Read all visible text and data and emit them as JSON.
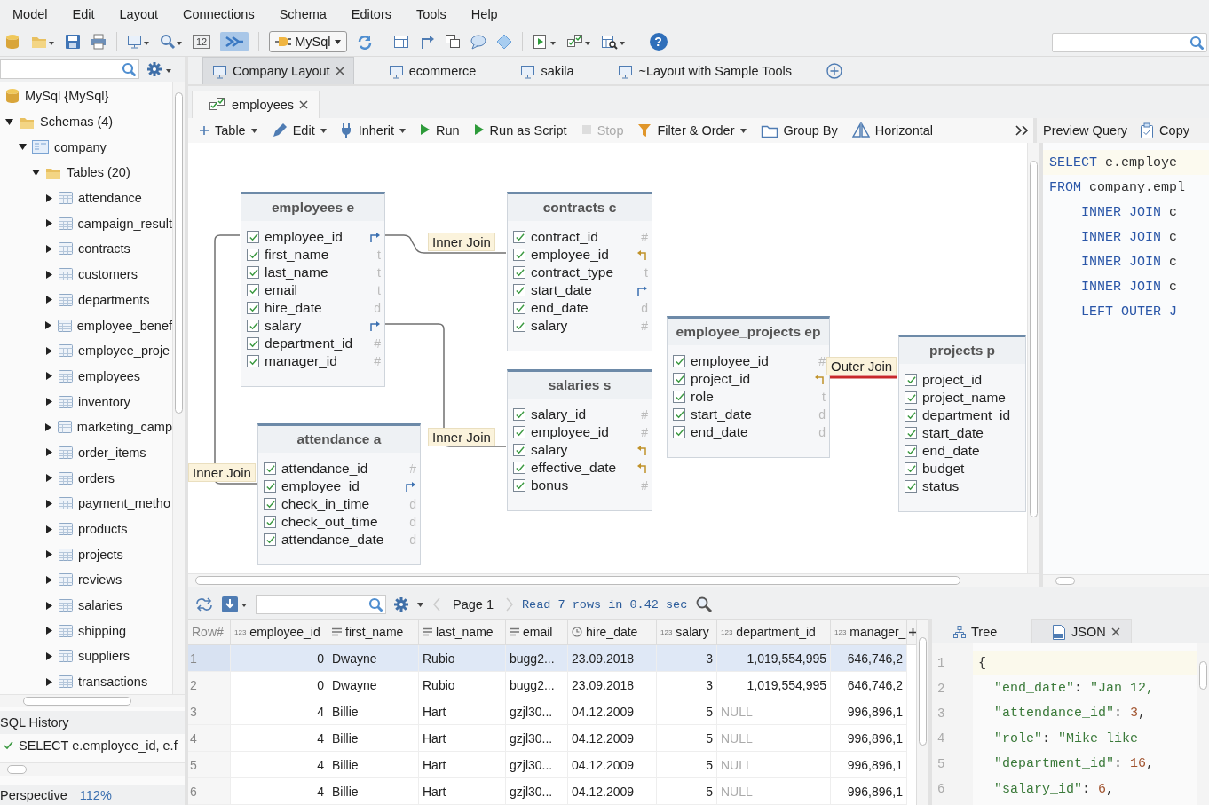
{
  "menu": [
    "Model",
    "Edit",
    "Layout",
    "Connections",
    "Schema",
    "Editors",
    "Tools",
    "Help"
  ],
  "toolbar": {
    "zoom_box": "12",
    "toggle_on": true,
    "connection": "MySql",
    "help": "?"
  },
  "navigator": {
    "tree": [
      {
        "label": "MySql {MySql}",
        "kind": "connection",
        "children": [
          {
            "label": "Schemas (4)",
            "kind": "folder",
            "expanded": true,
            "children": [
              {
                "label": "company",
                "kind": "schema",
                "expanded": true,
                "children": [
                  {
                    "label": "Tables (20)",
                    "kind": "folder",
                    "expanded": true,
                    "children": [
                      {
                        "label": "attendance",
                        "kind": "table",
                        "expanded": false
                      },
                      {
                        "label": "campaign_result",
                        "kind": "table",
                        "expanded": false
                      },
                      {
                        "label": "contracts",
                        "kind": "table",
                        "expanded": false
                      },
                      {
                        "label": "customers",
                        "kind": "table",
                        "expanded": false
                      },
                      {
                        "label": "departments",
                        "kind": "table",
                        "expanded": false
                      },
                      {
                        "label": "employee_benef",
                        "kind": "table",
                        "expanded": false
                      },
                      {
                        "label": "employee_proje",
                        "kind": "table",
                        "expanded": false
                      },
                      {
                        "label": "employees",
                        "kind": "table",
                        "expanded": false
                      },
                      {
                        "label": "inventory",
                        "kind": "table",
                        "expanded": false
                      },
                      {
                        "label": "marketing_camp",
                        "kind": "table",
                        "expanded": false
                      },
                      {
                        "label": "order_items",
                        "kind": "table",
                        "expanded": false
                      },
                      {
                        "label": "orders",
                        "kind": "table",
                        "expanded": false
                      },
                      {
                        "label": "payment_metho",
                        "kind": "table",
                        "expanded": false
                      },
                      {
                        "label": "products",
                        "kind": "table",
                        "expanded": false
                      },
                      {
                        "label": "projects",
                        "kind": "table",
                        "expanded": false
                      },
                      {
                        "label": "reviews",
                        "kind": "table",
                        "expanded": false
                      },
                      {
                        "label": "salaries",
                        "kind": "table",
                        "expanded": false
                      },
                      {
                        "label": "shipping",
                        "kind": "table",
                        "expanded": false
                      },
                      {
                        "label": "suppliers",
                        "kind": "table",
                        "expanded": false
                      },
                      {
                        "label": "transactions",
                        "kind": "table",
                        "expanded": false
                      }
                    ]
                  }
                ]
              }
            ]
          }
        ]
      }
    ],
    "history_title": "SQL History",
    "history": [
      {
        "text": "SELECT e.employee_id, e.f",
        "ok": true
      }
    ]
  },
  "status_bar": {
    "label": "Perspective",
    "zoom": "112%"
  },
  "layout_tabs": [
    {
      "label": "Company Layout",
      "selected": true,
      "closable": true
    },
    {
      "label": "ecommerce",
      "selected": false,
      "closable": false
    },
    {
      "label": "sakila",
      "selected": false,
      "closable": false
    },
    {
      "label": "~Layout with Sample Tools",
      "selected": false,
      "closable": false
    }
  ],
  "editor_tabs": [
    {
      "label": "employees",
      "selected": true,
      "closable": true
    }
  ],
  "query_toolbar": [
    {
      "label": "Table",
      "dropdown": true,
      "disabled": false
    },
    {
      "label": "Edit",
      "dropdown": true,
      "disabled": false
    },
    {
      "label": "Inherit",
      "dropdown": true,
      "disabled": false
    },
    {
      "label": "Run",
      "dropdown": false,
      "disabled": false
    },
    {
      "label": "Run as Script",
      "dropdown": false,
      "disabled": false
    },
    {
      "label": "Stop",
      "dropdown": false,
      "disabled": true
    },
    {
      "label": "Filter & Order",
      "dropdown": true,
      "disabled": false
    },
    {
      "label": "Group By",
      "dropdown": false,
      "disabled": false
    },
    {
      "label": "Horizontal",
      "dropdown": false,
      "disabled": false
    }
  ],
  "diagram": {
    "tables": [
      {
        "title": "employees e",
        "columns": [
          {
            "name": "employee_id",
            "checked": true,
            "kind": "outgoing"
          },
          {
            "name": "first_name",
            "checked": true,
            "type": "t"
          },
          {
            "name": "last_name",
            "checked": true,
            "type": "t"
          },
          {
            "name": "email",
            "checked": true,
            "type": "t"
          },
          {
            "name": "hire_date",
            "checked": true,
            "type": "d"
          },
          {
            "name": "salary",
            "checked": true,
            "kind": "outgoing"
          },
          {
            "name": "department_id",
            "checked": true,
            "type": "#"
          },
          {
            "name": "manager_id",
            "checked": true,
            "type": "#"
          }
        ]
      },
      {
        "title": "contracts c",
        "columns": [
          {
            "name": "contract_id",
            "checked": true,
            "type": "#"
          },
          {
            "name": "employee_id",
            "checked": true,
            "kind": "incoming"
          },
          {
            "name": "contract_type",
            "checked": true,
            "type": "t"
          },
          {
            "name": "start_date",
            "checked": true,
            "kind": "outgoing"
          },
          {
            "name": "end_date",
            "checked": true,
            "type": "d"
          },
          {
            "name": "salary",
            "checked": true,
            "type": "#"
          }
        ]
      },
      {
        "title": "salaries s",
        "columns": [
          {
            "name": "salary_id",
            "checked": true,
            "type": "#"
          },
          {
            "name": "employee_id",
            "checked": true,
            "type": "#"
          },
          {
            "name": "salary",
            "checked": true,
            "kind": "incoming"
          },
          {
            "name": "effective_date",
            "checked": true,
            "kind": "incoming"
          },
          {
            "name": "bonus",
            "checked": true,
            "type": "#"
          }
        ]
      },
      {
        "title": "attendance a",
        "columns": [
          {
            "name": "attendance_id",
            "checked": true,
            "type": "#"
          },
          {
            "name": "employee_id",
            "checked": true,
            "kind": "outgoing"
          },
          {
            "name": "check_in_time",
            "checked": true,
            "type": "d"
          },
          {
            "name": "check_out_time",
            "checked": true,
            "type": "d"
          },
          {
            "name": "attendance_date",
            "checked": true,
            "type": "d"
          }
        ]
      },
      {
        "title": "employee_projects ep",
        "columns": [
          {
            "name": "employee_id",
            "checked": true,
            "type": "#"
          },
          {
            "name": "project_id",
            "checked": true,
            "kind": "incoming"
          },
          {
            "name": "role",
            "checked": true,
            "type": "t"
          },
          {
            "name": "start_date",
            "checked": true,
            "type": "d"
          },
          {
            "name": "end_date",
            "checked": true,
            "type": "d"
          }
        ]
      },
      {
        "title": "projects p",
        "columns": [
          {
            "name": "project_id",
            "checked": true
          },
          {
            "name": "project_name",
            "checked": true
          },
          {
            "name": "department_id",
            "checked": true
          },
          {
            "name": "start_date",
            "checked": true
          },
          {
            "name": "end_date",
            "checked": true
          },
          {
            "name": "budget",
            "checked": true
          },
          {
            "name": "status",
            "checked": true
          }
        ]
      }
    ],
    "joins": [
      {
        "label": "Inner Join",
        "kind": "inner"
      },
      {
        "label": "Inner Join",
        "kind": "inner"
      },
      {
        "label": "Inner Join",
        "kind": "inner"
      },
      {
        "label": "Outer Join",
        "kind": "outer"
      }
    ]
  },
  "preview": {
    "title": "Preview Query",
    "copy": "Copy",
    "lines": [
      {
        "current": true,
        "segments": [
          {
            "text": "SELECT",
            "keyword": true
          },
          {
            "text": " e.employe",
            "keyword": false
          }
        ]
      },
      {
        "current": false,
        "segments": [
          {
            "text": "FROM",
            "keyword": true
          },
          {
            "text": " company.empl",
            "keyword": false
          }
        ]
      },
      {
        "current": false,
        "segments": [
          {
            "text": "    INNER JOIN",
            "keyword": true
          },
          {
            "text": " c",
            "keyword": false
          }
        ]
      },
      {
        "current": false,
        "segments": [
          {
            "text": "    INNER JOIN",
            "keyword": true
          },
          {
            "text": " c",
            "keyword": false
          }
        ]
      },
      {
        "current": false,
        "segments": [
          {
            "text": "    INNER JOIN",
            "keyword": true
          },
          {
            "text": " c",
            "keyword": false
          }
        ]
      },
      {
        "current": false,
        "segments": [
          {
            "text": "    INNER JOIN",
            "keyword": true
          },
          {
            "text": " c",
            "keyword": false
          }
        ]
      },
      {
        "current": false,
        "segments": [
          {
            "text": "    LEFT OUTER J",
            "keyword": true
          }
        ]
      }
    ]
  },
  "results": {
    "page": "Page 1",
    "summary": "Read 7 rows in 0.42 sec",
    "columns": [
      {
        "label": "Row#",
        "kind": "row"
      },
      {
        "label": "employee_id",
        "kind": "number",
        "mark": "123"
      },
      {
        "label": "first_name",
        "kind": "text"
      },
      {
        "label": "last_name",
        "kind": "text"
      },
      {
        "label": "email",
        "kind": "text"
      },
      {
        "label": "hire_date",
        "kind": "date"
      },
      {
        "label": "salary",
        "kind": "number",
        "mark": "123"
      },
      {
        "label": "department_id",
        "kind": "number",
        "mark": "123"
      },
      {
        "label": "manager_",
        "kind": "number",
        "mark": "123"
      }
    ],
    "rows": [
      {
        "selected": true,
        "cells": [
          "1",
          "0",
          "Dwayne",
          "Rubio",
          "bugg2...",
          "23.09.2018",
          "3",
          "1,019,554,995",
          "646,746,2"
        ]
      },
      {
        "selected": false,
        "cells": [
          "2",
          "0",
          "Dwayne",
          "Rubio",
          "bugg2...",
          "23.09.2018",
          "3",
          "1,019,554,995",
          "646,746,2"
        ]
      },
      {
        "selected": false,
        "cells": [
          "3",
          "4",
          "Billie",
          "Hart",
          "gzjl30...",
          "04.12.2009",
          "5",
          {
            "text": "NULL",
            "null": true
          },
          "996,896,1"
        ]
      },
      {
        "selected": false,
        "cells": [
          "4",
          "4",
          "Billie",
          "Hart",
          "gzjl30...",
          "04.12.2009",
          "5",
          {
            "text": "NULL",
            "null": true
          },
          "996,896,1"
        ]
      },
      {
        "selected": false,
        "cells": [
          "5",
          "4",
          "Billie",
          "Hart",
          "gzjl30...",
          "04.12.2009",
          "5",
          {
            "text": "NULL",
            "null": true
          },
          "996,896,1"
        ]
      },
      {
        "selected": false,
        "cells": [
          "6",
          "4",
          "Billie",
          "Hart",
          "gzjl30...",
          "04.12.2009",
          "5",
          {
            "text": "NULL",
            "null": true
          },
          "996,896,1"
        ]
      }
    ]
  },
  "record": {
    "tabs": [
      {
        "label": "Tree",
        "selected": false,
        "closable": false
      },
      {
        "label": "JSON",
        "selected": true,
        "closable": true
      }
    ],
    "lines": [
      {
        "number": "1",
        "current": true,
        "segments": [
          {
            "text": "{",
            "kind": "punct"
          }
        ]
      },
      {
        "number": "2",
        "current": false,
        "segments": [
          {
            "text": "  \"end_date\"",
            "kind": "key"
          },
          {
            "text": ": ",
            "kind": "punct"
          },
          {
            "text": "\"Jan 12,",
            "kind": "string"
          }
        ]
      },
      {
        "number": "3",
        "current": false,
        "segments": [
          {
            "text": "  \"attendance_id\"",
            "kind": "key"
          },
          {
            "text": ": ",
            "kind": "punct"
          },
          {
            "text": "3",
            "kind": "number"
          },
          {
            "text": ",",
            "kind": "punct"
          }
        ]
      },
      {
        "number": "4",
        "current": false,
        "segments": [
          {
            "text": "  \"role\"",
            "kind": "key"
          },
          {
            "text": ": ",
            "kind": "punct"
          },
          {
            "text": "\"Mike like",
            "kind": "string"
          }
        ]
      },
      {
        "number": "5",
        "current": false,
        "segments": [
          {
            "text": "  \"department_id\"",
            "kind": "key"
          },
          {
            "text": ": ",
            "kind": "punct"
          },
          {
            "text": "16",
            "kind": "number"
          },
          {
            "text": ",",
            "kind": "punct"
          }
        ]
      },
      {
        "number": "6",
        "current": false,
        "segments": [
          {
            "text": "  \"salary_id\"",
            "kind": "key"
          },
          {
            "text": ": ",
            "kind": "punct"
          },
          {
            "text": "6",
            "kind": "number"
          },
          {
            "text": ",",
            "kind": "punct"
          }
        ]
      }
    ]
  }
}
